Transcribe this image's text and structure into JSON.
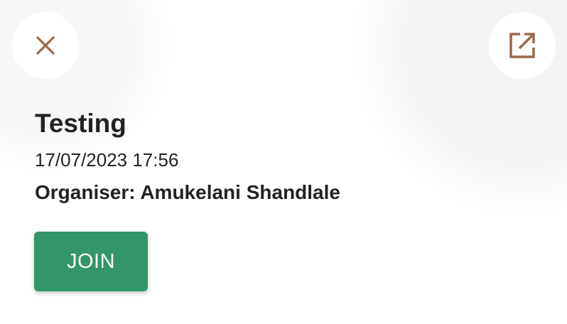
{
  "colors": {
    "icon_accent": "#9a6a4a",
    "join_button_bg": "#33956a",
    "join_button_text": "#ffffff",
    "text": "#222222"
  },
  "header": {
    "close_icon": "close-icon",
    "open_external_icon": "open-in-new-icon"
  },
  "event": {
    "title": "Testing",
    "datetime": "17/07/2023 17:56",
    "organiser": "Organiser: Amukelani Shandlale"
  },
  "actions": {
    "join_label": "JOIN"
  }
}
